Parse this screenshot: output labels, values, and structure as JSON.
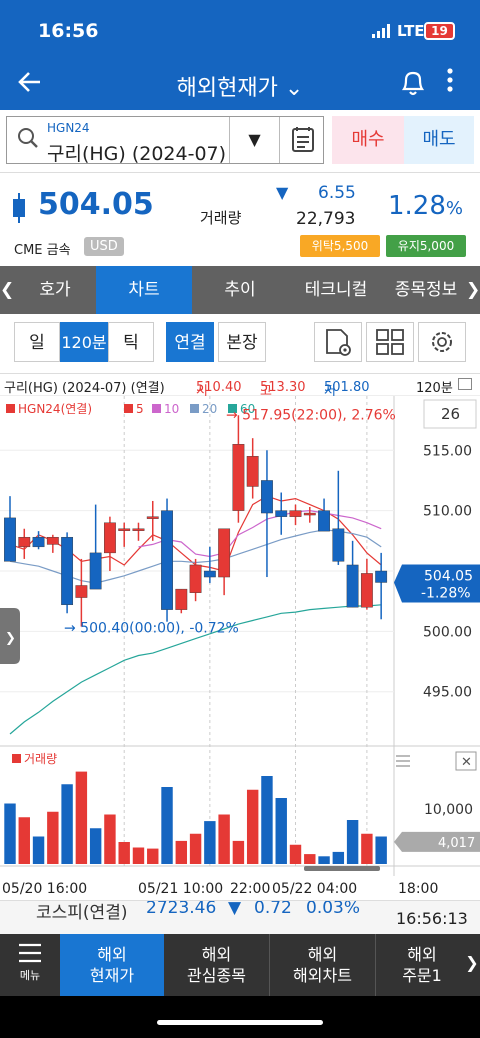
{
  "status": {
    "time": "16:56",
    "network": "LTE",
    "battery": "19"
  },
  "appbar": {
    "title": "해외현재가",
    "title_caret": "⌄"
  },
  "search": {
    "code": "HGN24",
    "name": "구리(HG) (2024-07)",
    "dropdown": "▼",
    "buy": "매수",
    "sell": "매도"
  },
  "price": {
    "last": "504.05",
    "volume_label": "거래량",
    "direction": "▼",
    "change": "6.55",
    "volume": "22,793",
    "pct": "1.28",
    "pct_unit": "%",
    "exchange": "CME 금속",
    "currency": "USD",
    "badge1": "위탁5,500",
    "badge2": "유지5,000"
  },
  "tabs": {
    "left": "❮",
    "items": [
      "호가",
      "차트",
      "추이",
      "테크니컬",
      "종목정보"
    ],
    "right": "❯"
  },
  "toolbar": {
    "day": "일",
    "interval": "120분",
    "tick": "틱",
    "linked": "연결",
    "main": "본장"
  },
  "info": {
    "name": "구리(HG) (2024-07) (연결)",
    "open_label": "시",
    "open": "510.40",
    "high_label": "고",
    "high": "513.30",
    "low_label": "저",
    "low": "501.80",
    "interval": "120분"
  },
  "chart_data": {
    "type": "candlestick",
    "legend": {
      "series": "HGN24(연결)",
      "ma": [
        "5",
        "10",
        "20",
        "60"
      ]
    },
    "ma_colors": [
      "#e53935",
      "#cc66cc",
      "#7a9cc6",
      "#26a69a"
    ],
    "count_box": "26",
    "ylim": [
      491.5,
      518.5
    ],
    "y_ticks": [
      "515.00",
      "510.00",
      "505.00",
      "500.00",
      "495.00"
    ],
    "x_labels": [
      "05/20 16:00",
      "05/21 10:00",
      "22:00",
      "05/22 04:00",
      "18:00"
    ],
    "candles": [
      {
        "o": 509.4,
        "h": 511.2,
        "l": 507.0,
        "c": 505.8
      },
      {
        "o": 507.0,
        "h": 508.5,
        "l": 506.0,
        "c": 507.8
      },
      {
        "o": 507.8,
        "h": 508.3,
        "l": 506.8,
        "c": 507.0
      },
      {
        "o": 507.2,
        "h": 508.0,
        "l": 506.5,
        "c": 507.8
      },
      {
        "o": 507.8,
        "h": 508.2,
        "l": 501.5,
        "c": 502.2
      },
      {
        "o": 502.8,
        "h": 506.0,
        "l": 500.4,
        "c": 503.8
      },
      {
        "o": 506.5,
        "h": 510.5,
        "l": 504.5,
        "c": 503.5
      },
      {
        "o": 506.5,
        "h": 509.5,
        "l": 505.0,
        "c": 509.0
      },
      {
        "o": 508.5,
        "h": 509.0,
        "l": 507.0,
        "c": 508.5
      },
      {
        "o": 508.5,
        "h": 509.0,
        "l": 507.5,
        "c": 508.5
      },
      {
        "o": 509.5,
        "h": 510.8,
        "l": 507.5,
        "c": 509.5
      },
      {
        "o": 510.0,
        "h": 511.0,
        "l": 500.8,
        "c": 501.8
      },
      {
        "o": 501.8,
        "h": 503.5,
        "l": 501.5,
        "c": 503.5
      },
      {
        "o": 503.2,
        "h": 506.0,
        "l": 502.5,
        "c": 505.5
      },
      {
        "o": 505.0,
        "h": 507.0,
        "l": 504.0,
        "c": 504.5
      },
      {
        "o": 504.5,
        "h": 506.5,
        "l": 503.0,
        "c": 508.5
      },
      {
        "o": 510.0,
        "h": 517.9,
        "l": 509.0,
        "c": 515.5
      },
      {
        "o": 512.0,
        "h": 516.0,
        "l": 511.0,
        "c": 514.5
      },
      {
        "o": 512.5,
        "h": 515.0,
        "l": 504.5,
        "c": 509.8
      },
      {
        "o": 510.0,
        "h": 511.5,
        "l": 508.0,
        "c": 509.5
      },
      {
        "o": 509.5,
        "h": 510.5,
        "l": 508.8,
        "c": 510.0
      },
      {
        "o": 509.8,
        "h": 510.3,
        "l": 509.0,
        "c": 509.8
      },
      {
        "o": 510.0,
        "h": 511.0,
        "l": 508.5,
        "c": 508.3
      },
      {
        "o": 508.5,
        "h": 513.3,
        "l": 505.5,
        "c": 505.8
      },
      {
        "o": 505.5,
        "h": 507.5,
        "l": 502.0,
        "c": 502.0
      },
      {
        "o": 502.0,
        "h": 506.0,
        "l": 501.8,
        "c": 504.8
      },
      {
        "o": 505.0,
        "h": 506.5,
        "l": 501.0,
        "c": 504.05
      }
    ],
    "ma5": [
      507.2,
      506.8,
      508.0,
      507.5,
      506.8,
      505.8,
      506.0,
      506.2,
      505.5,
      506.8,
      508.0,
      507.5,
      506.5,
      505.5,
      505.3,
      505.0,
      508.2,
      510.5,
      511.2,
      510.8,
      511.0,
      510.5,
      510.0,
      509.3,
      508.0,
      506.5,
      505.5
    ],
    "ma10": [
      null,
      null,
      null,
      null,
      null,
      null,
      null,
      null,
      null,
      507.0,
      507.2,
      507.6,
      507.4,
      506.4,
      506.2,
      506.5,
      508.0,
      508.6,
      509.3,
      509.6,
      509.9,
      510.0,
      509.8,
      509.6,
      509.4,
      509.0,
      508.5
    ],
    "ma20": [
      505.8,
      505.6,
      505.4,
      505.0,
      504.6,
      504.2,
      504.0,
      504.3,
      504.6,
      505.0,
      505.4,
      505.8,
      505.8,
      505.7,
      505.8,
      506.0,
      506.4,
      506.8,
      507.2,
      507.6,
      507.9,
      508.2,
      508.4,
      508.3,
      508.1,
      507.8,
      507.0
    ],
    "ma60": [
      491.5,
      492.5,
      493.3,
      494.2,
      495.0,
      495.8,
      496.4,
      497.0,
      497.6,
      498.0,
      498.2,
      498.6,
      499.0,
      499.4,
      499.8,
      500.2,
      500.6,
      500.9,
      501.2,
      501.5,
      501.6,
      501.8,
      501.9,
      502.0,
      502.1,
      502.1,
      502.2
    ],
    "high_note": "517.95(22:00), 2.76%",
    "low_note": "500.40(00:00), -0.72%",
    "current_label": "504.05",
    "current_pct": "-1.28%",
    "volume_title": "거래량",
    "volume_tick": "10,000",
    "volume_current": "4,017",
    "volumes": [
      11000,
      8500,
      5000,
      9500,
      14500,
      16800,
      6500,
      9000,
      4000,
      3000,
      2800,
      14000,
      4200,
      5500,
      7800,
      9000,
      4200,
      13500,
      16000,
      12000,
      3500,
      1800,
      1400,
      2200,
      8000,
      5500,
      5000
    ]
  },
  "quote": {
    "index_name": "코스피(연결)",
    "value": "2723.46",
    "dir": "▼",
    "change": "0.72",
    "pct": "0.03%",
    "time": "16:56:13"
  },
  "bottomnav": {
    "menu": "메뉴",
    "items": [
      [
        "해외",
        "현재가"
      ],
      [
        "해외",
        "관심종목"
      ],
      [
        "해외",
        "해외차트"
      ],
      [
        "해외",
        "주문1"
      ]
    ],
    "next": "❯"
  },
  "colors": {
    "up": "#e53935",
    "down": "#1565c0",
    "accent": "#1976d2"
  }
}
